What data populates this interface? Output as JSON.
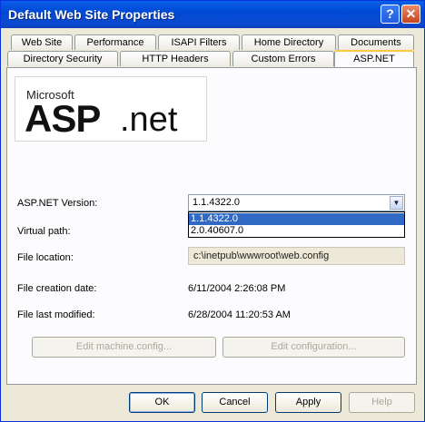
{
  "window": {
    "title": "Default Web Site Properties",
    "help_glyph": "?",
    "close_glyph": "✕"
  },
  "tabs_row1": [
    "Web Site",
    "Performance",
    "ISAPI Filters",
    "Home Directory",
    "Documents"
  ],
  "tabs_row2": [
    "Directory Security",
    "HTTP Headers",
    "Custom Errors",
    "ASP.NET"
  ],
  "active_tab": "ASP.NET",
  "logo": {
    "brand_small": "Microsoft",
    "brand_large": "ASP",
    "brand_suffix": ".net"
  },
  "form": {
    "version_label": "ASP.NET Version:",
    "version_value": "1.1.4322.0",
    "version_options": [
      "1.1.4322.0",
      "2.0.40607.0"
    ],
    "virtual_path_label": "Virtual path:",
    "file_location_label": "File location:",
    "file_location_value": "c:\\inetpub\\wwwroot\\web.config",
    "creation_label": "File creation date:",
    "creation_value": "6/11/2004 2:26:08 PM",
    "modified_label": "File last modified:",
    "modified_value": "6/28/2004 11:20:53 AM",
    "edit_machine_button": "Edit machine.config...",
    "edit_config_button": "Edit configuration..."
  },
  "footer": {
    "ok": "OK",
    "cancel": "Cancel",
    "apply": "Apply",
    "help": "Help"
  },
  "colors": {
    "titlebar": "#0054e3",
    "selection": "#316ac5",
    "active_tab_accent": "#ffc83c"
  }
}
